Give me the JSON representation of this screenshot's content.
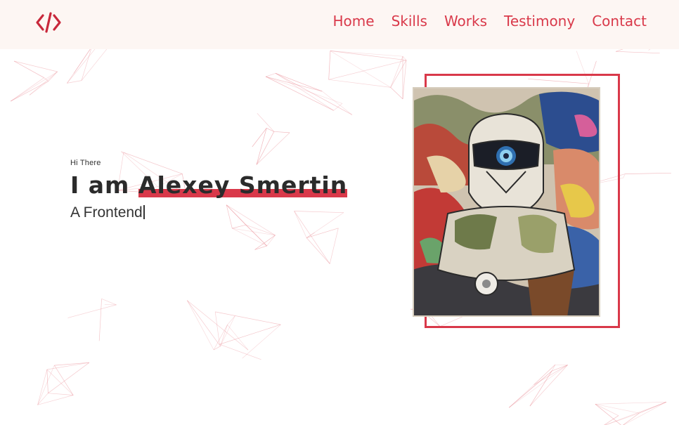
{
  "header": {
    "logo_icon": "code-brackets-icon",
    "nav": [
      {
        "label": "Home"
      },
      {
        "label": "Skills"
      },
      {
        "label": "Works"
      },
      {
        "label": "Testimony"
      },
      {
        "label": "Contact"
      }
    ]
  },
  "hero": {
    "greeting": "Hi There",
    "headline_prefix": "I am",
    "name": "Alexey Smertin",
    "role_text": "A Frontend"
  },
  "colors": {
    "accent": "#d9394a",
    "header_bg": "#fdf6f3",
    "text_dark": "#2b2b2b"
  }
}
